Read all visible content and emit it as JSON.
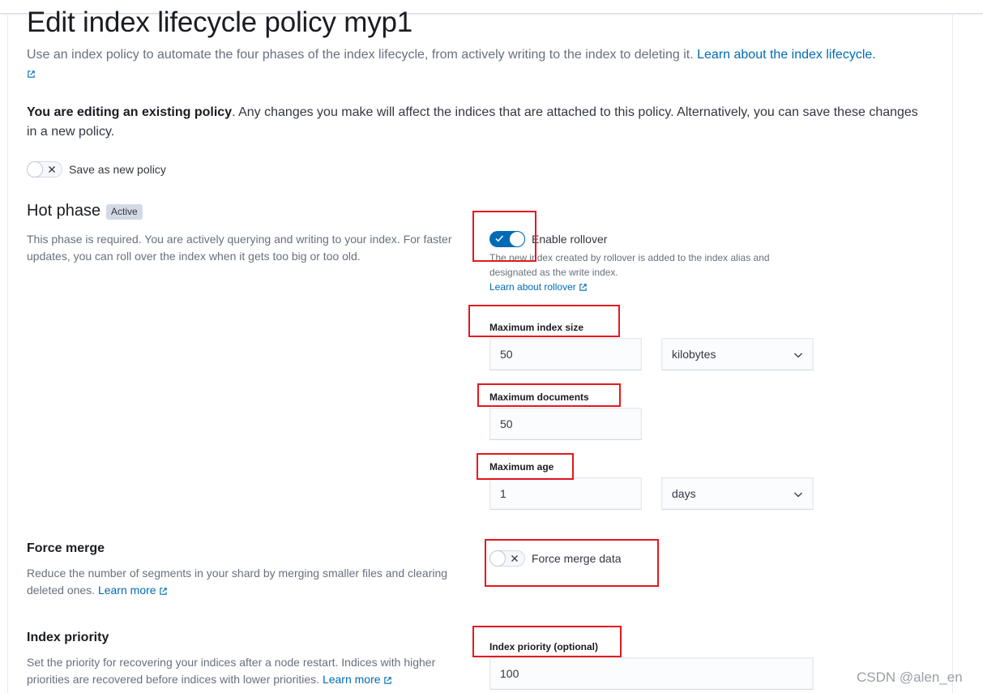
{
  "page": {
    "title": "Edit index lifecycle policy myp1",
    "intro_text": "Use an index policy to automate the four phases of the index lifecycle, from actively writing to the index to deleting it.",
    "intro_link": "Learn about the index lifecycle.",
    "editing_bold": "You are editing an existing policy",
    "editing_text": ". Any changes you make will affect the indices that are attached to this policy. Alternatively, you can save these changes in a new policy."
  },
  "save_as_new": {
    "label": "Save as new policy",
    "enabled": false
  },
  "hot_phase": {
    "title": "Hot phase",
    "badge": "Active",
    "description": "This phase is required. You are actively querying and writing to your index. For faster updates, you can roll over the index when it gets too big or too old.",
    "rollover": {
      "label": "Enable rollover",
      "enabled": true,
      "help": "The new index created by rollover is added to the index alias and designated as the write index.",
      "link": "Learn about rollover"
    },
    "max_index_size": {
      "label": "Maximum index size",
      "value": "50",
      "unit": "kilobytes"
    },
    "max_documents": {
      "label": "Maximum documents",
      "value": "50"
    },
    "max_age": {
      "label": "Maximum age",
      "value": "1",
      "unit": "days"
    }
  },
  "force_merge": {
    "title": "Force merge",
    "description": "Reduce the number of segments in your shard by merging smaller files and clearing deleted ones.",
    "link": "Learn more",
    "toggle_label": "Force merge data",
    "enabled": false
  },
  "index_priority": {
    "title": "Index priority",
    "description": "Set the priority for recovering your indices after a node restart. Indices with higher priorities are recovered before indices with lower priorities.",
    "link": "Learn more",
    "field_label": "Index priority (optional)",
    "value": "100"
  },
  "watermark": "CSDN @alen_en",
  "colors": {
    "accent": "#006bb4",
    "annotation": "#e5181e",
    "text": "#343741",
    "subdued": "#69707d"
  },
  "icons": [
    "external-link-icon",
    "check-icon",
    "cross-icon",
    "chevron-down-icon"
  ]
}
